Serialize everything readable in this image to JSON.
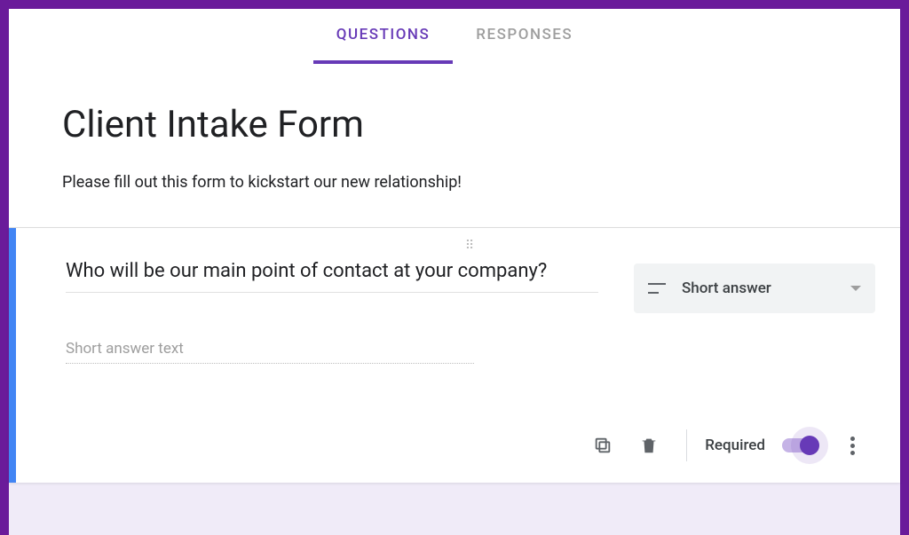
{
  "colors": {
    "accent": "#673ab7",
    "frame": "#6a1b9a",
    "active_border": "#4285f4"
  },
  "tabs": {
    "questions": "QUESTIONS",
    "responses": "RESPONSES"
  },
  "header": {
    "title": "Client Intake Form",
    "description": "Please fill out this form to kickstart our new relationship!"
  },
  "question": {
    "text": "Who will be our main point of contact at your company?",
    "type_label": "Short answer",
    "answer_placeholder": "Short answer text",
    "required_label": "Required",
    "required_state": true
  }
}
